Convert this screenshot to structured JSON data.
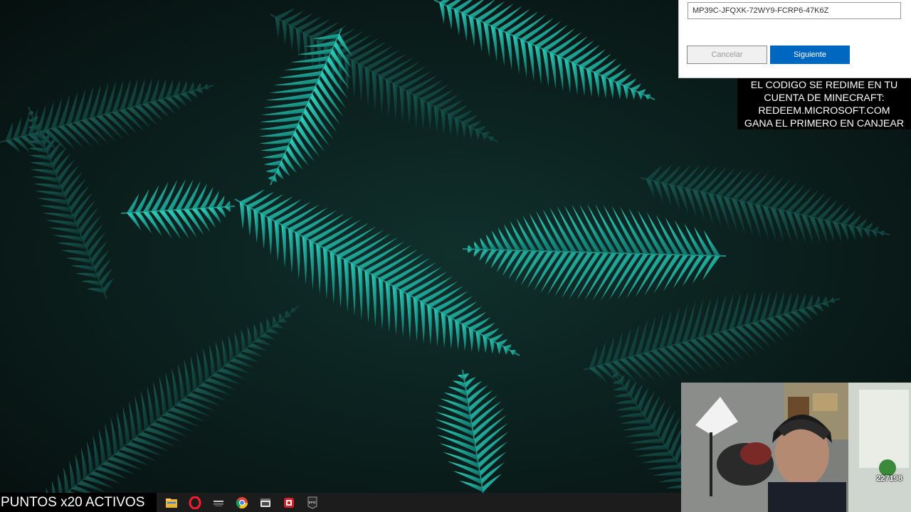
{
  "dialog": {
    "code_value": "MP39C-JFQXK-72WY9-FCRP6-47K6Z",
    "cancel_label": "Cancelar",
    "next_label": "Siguiente"
  },
  "notice": {
    "lines": [
      "EL CODIGO SE REDIME EN TU",
      "CUENTA DE MINECRAFT:",
      "REDEEM.MICROSOFT.COM",
      "GANA EL PRIMERO EN CANJEAR"
    ]
  },
  "webcam": {
    "viewer_count": "227198"
  },
  "taskbar": {
    "points_label": "PUNTOS x20 ACTIVOS",
    "icons": [
      "file-explorer-icon",
      "opera-gx-icon",
      "launcher-icon",
      "chrome-icon",
      "app-window-icon",
      "red-app-icon",
      "epic-games-icon"
    ],
    "epic_label": "EPIC"
  },
  "colors": {
    "accent_button": "#0067c0",
    "fern": "#1fa89a",
    "wallpaper": "#0a1412"
  }
}
